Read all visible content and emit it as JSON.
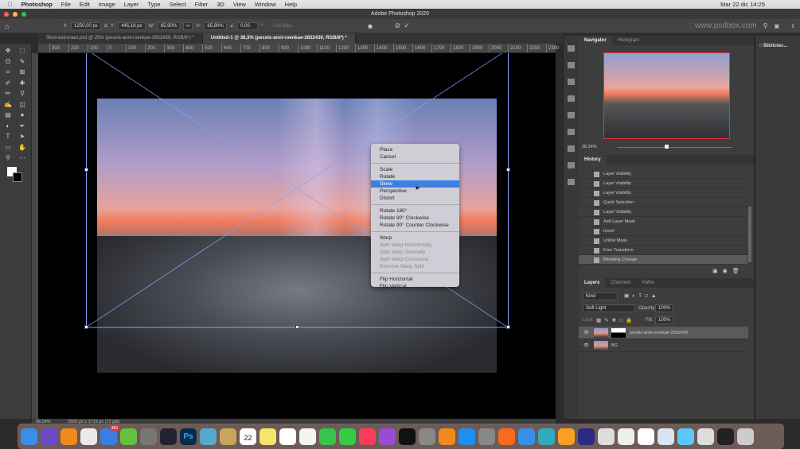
{
  "menubar": {
    "app": "Photoshop",
    "items": [
      "File",
      "Edit",
      "Image",
      "Layer",
      "Type",
      "Select",
      "Filter",
      "3D",
      "View",
      "Window",
      "Help"
    ],
    "clock": "Mar 22 dic  14:25"
  },
  "window": {
    "title": "Adobe Photoshop 2020"
  },
  "options": {
    "x_label": "X:",
    "x": "1250,00 px",
    "y_label": "Y:",
    "y": "445,18 px",
    "w_label": "W:",
    "w": "65,90%",
    "h_label": "H:",
    "h": "65,90%",
    "angle": "0,00",
    "angle_unit": "°",
    "antialias": "Anti-alias",
    "watermark": "www.psdbox.com"
  },
  "tabs": [
    {
      "label": "Skull-astronaut.psd @ 25% (pexels-anni-roenkae-2832439, RGB/8*) *",
      "active": false
    },
    {
      "label": "Untitled-1 @ 38,3% (pexels-anni-roenkae-2832439, RGB/8*) *",
      "active": true
    }
  ],
  "ruler": [
    "300",
    "200",
    "100",
    "0",
    "100",
    "200",
    "300",
    "400",
    "500",
    "600",
    "700",
    "800",
    "900",
    "1000",
    "1100",
    "1200",
    "1300",
    "1400",
    "1500",
    "1600",
    "1700",
    "1800",
    "1900",
    "2000",
    "2100",
    "2200",
    "2300",
    "2400",
    "2500",
    "2600",
    "2700",
    "280"
  ],
  "context_menu": [
    {
      "label": "Place"
    },
    {
      "label": "Cancel"
    },
    {
      "sep": true
    },
    {
      "label": "Scale"
    },
    {
      "label": "Rotate"
    },
    {
      "label": "Skew",
      "selected": true
    },
    {
      "label": "Perspective"
    },
    {
      "label": "Distort"
    },
    {
      "sep": true
    },
    {
      "label": "Rotate 180°"
    },
    {
      "label": "Rotate 90° Clockwise"
    },
    {
      "label": "Rotate 90° Counter Clockwise"
    },
    {
      "sep": true
    },
    {
      "label": "Warp"
    },
    {
      "label": "Split Warp Horizontally",
      "disabled": true
    },
    {
      "label": "Split Warp Vertically",
      "disabled": true
    },
    {
      "label": "Split Warp Crosswise",
      "disabled": true
    },
    {
      "label": "Remove Warp Split",
      "disabled": true
    },
    {
      "sep": true
    },
    {
      "label": "Flip Horizontal"
    },
    {
      "label": "Flip Vertical"
    }
  ],
  "navigator": {
    "tabs": [
      "Navigator",
      "Histogram"
    ],
    "zoom": "38,34%"
  },
  "history": {
    "title": "History",
    "items": [
      "Layer Visibility",
      "Layer Visibility",
      "Layer Visibility",
      "Quick Selection",
      "Layer Visibility",
      "Add Layer Mask",
      "Invert",
      "Unlink Mask",
      "Free Transform",
      "Blending Change"
    ],
    "current": 9
  },
  "layers": {
    "tabs": [
      "Layers",
      "Channels",
      "Paths"
    ],
    "filter_placeholder": "Kind",
    "blend": "Soft Light",
    "opacity_label": "Opacity:",
    "opacity": "100%",
    "lock_label": "Lock:",
    "fill_label": "Fill:",
    "fill": "100%",
    "items": [
      {
        "name": "pexels-anni-roenkae-2832439",
        "selected": true
      },
      {
        "name": "BG",
        "selected": false
      }
    ]
  },
  "libraries": {
    "label": "Bibliotec..."
  },
  "status": {
    "zoom": "38,34%",
    "doc": "2500 px x 1719 px (72 ppi)"
  },
  "dock": {
    "badge": "350",
    "apps": [
      "finder",
      "siri",
      "vlc",
      "chrome",
      "spark",
      "camtasia",
      "rocket",
      "activity-monitor",
      "photoshop",
      "preview",
      "notes",
      "calendar",
      "stickies",
      "reminders",
      "photos",
      "messages",
      "facetime",
      "music",
      "podcasts",
      "apple-tv",
      "help",
      "books",
      "app-store",
      "system-preferences",
      "firefox",
      "mail",
      "screenflow",
      "illustrator",
      "audition",
      "script-editor",
      "documents",
      "textedit",
      "files",
      "downloads",
      "screenshot",
      "terminal",
      "trash"
    ],
    "calendar_day": "22"
  }
}
